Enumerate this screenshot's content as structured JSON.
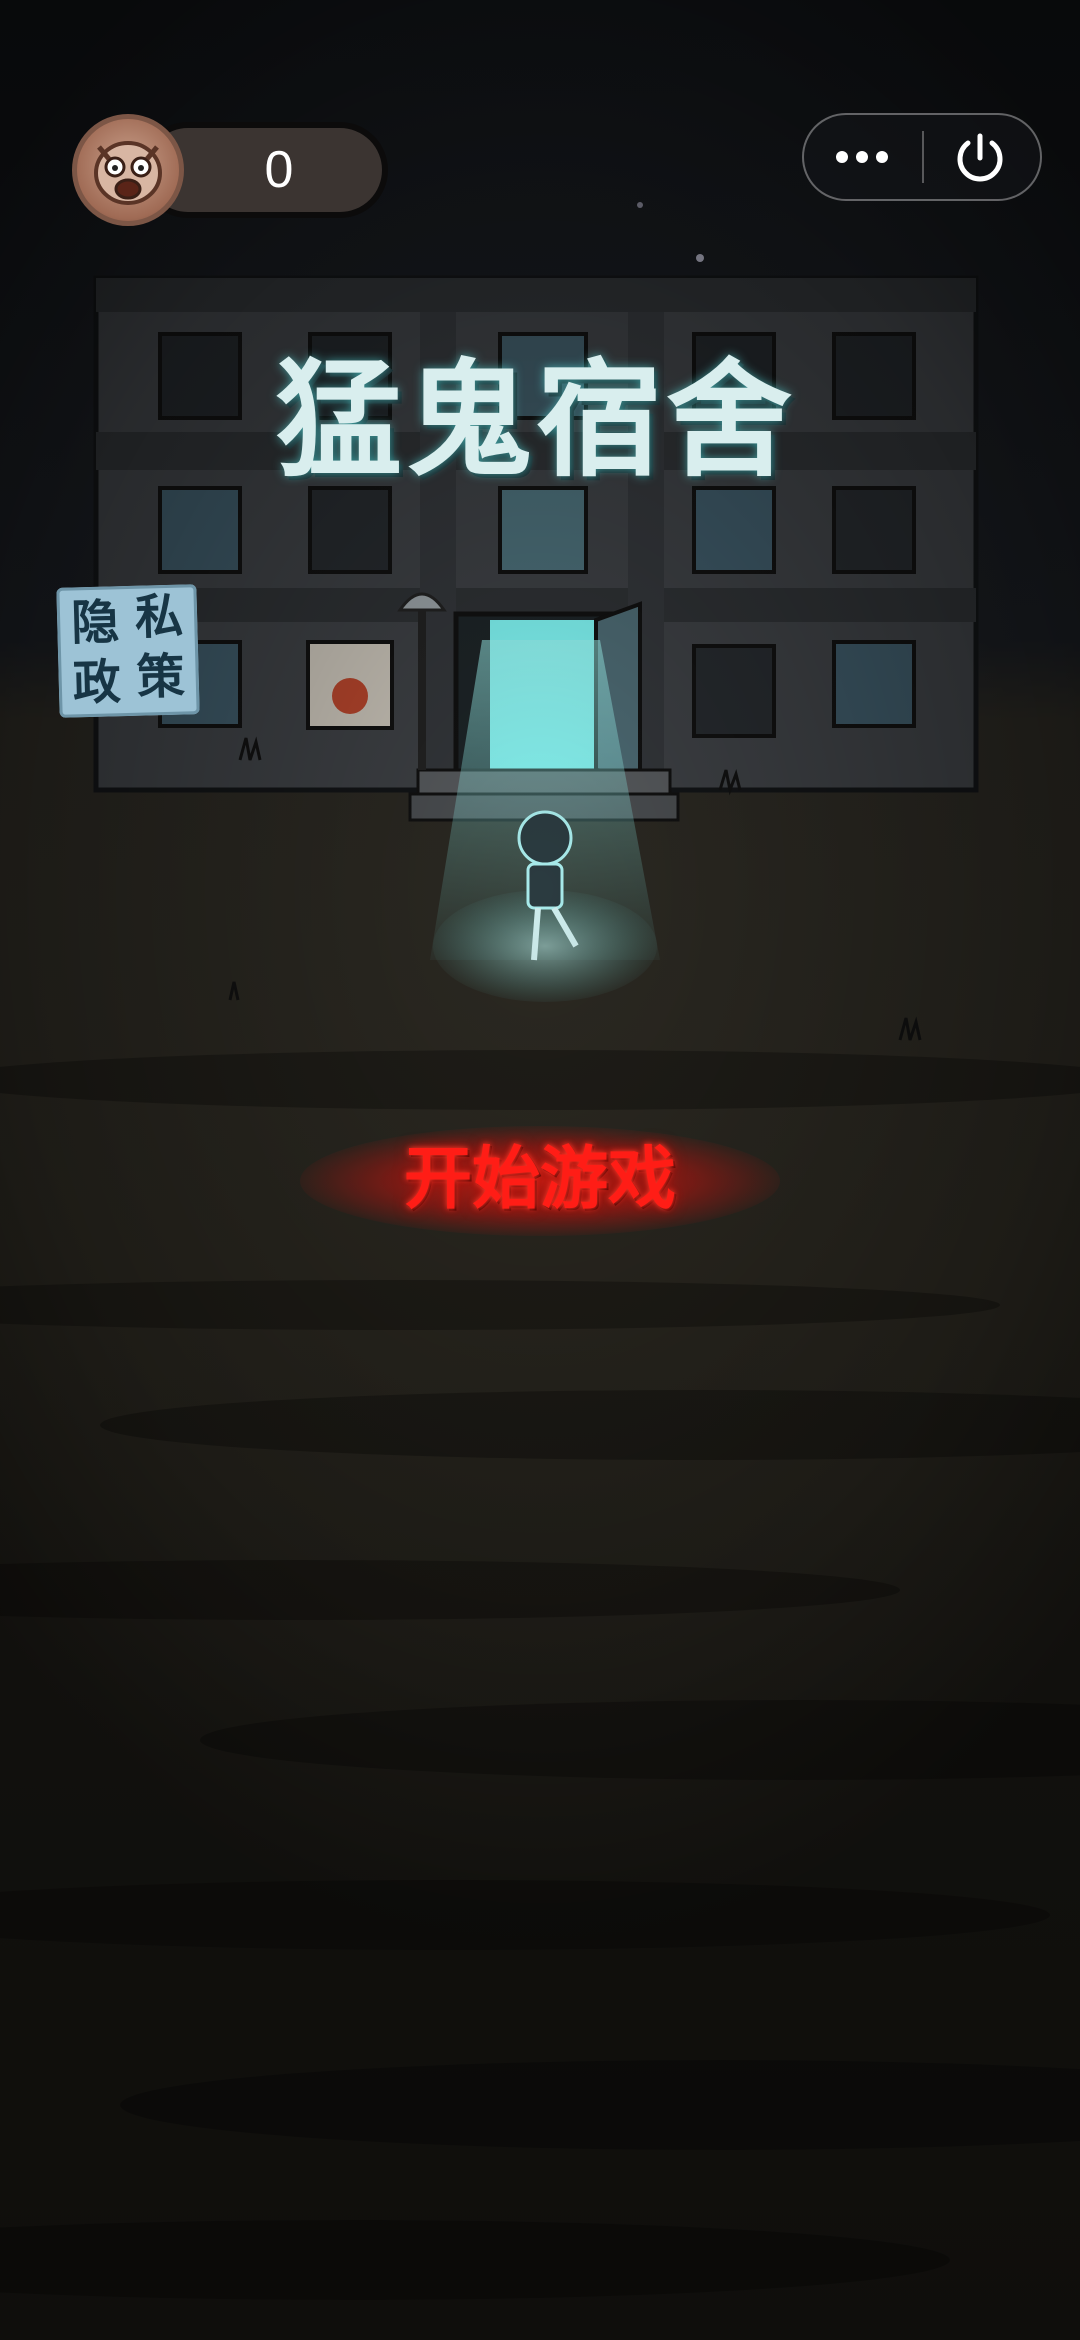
{
  "hud": {
    "score": "0",
    "avatar_icon": "pig-ghost-face-icon"
  },
  "capsule_menu": {
    "more_icon": "ellipsis-icon",
    "close_icon": "power-icon"
  },
  "privacy_badge": {
    "chars": [
      "隐",
      "私",
      "政",
      "策"
    ]
  },
  "title": "猛鬼宿舍",
  "start_button_label": "开始游戏",
  "colors": {
    "title_glow": "#5af0f0",
    "start_button": "#ff1d16",
    "door_light": "#7ff5f3",
    "score_pill": "#3b3431",
    "privacy_badge": "#9dc3d6"
  }
}
